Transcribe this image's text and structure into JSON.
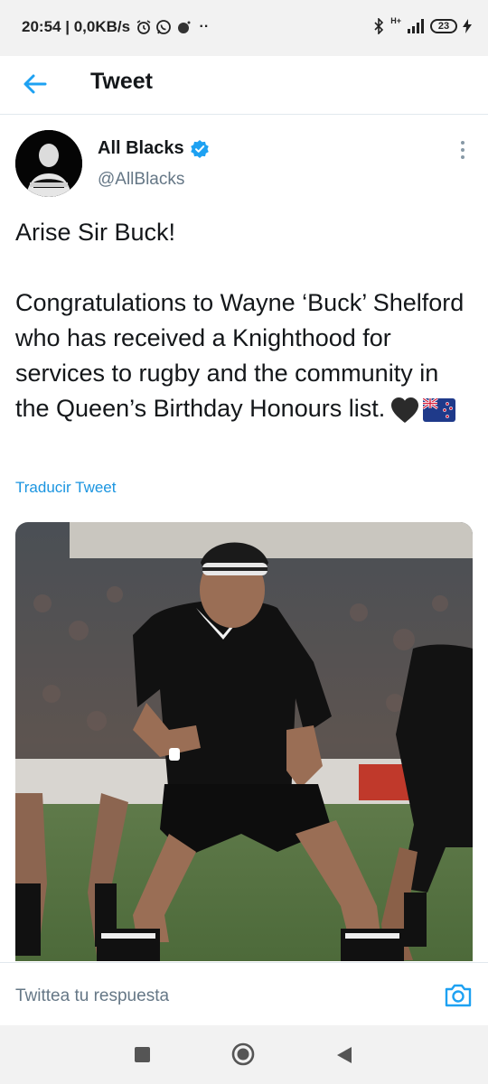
{
  "status_bar": {
    "time": "20:54",
    "speed": "0,0KB/s",
    "network": "H+",
    "battery": "23"
  },
  "header": {
    "title": "Tweet"
  },
  "tweet": {
    "display_name": "All Blacks",
    "handle": "@AllBlacks",
    "verified": true,
    "text": "Arise Sir Buck!\n\nCongratulations to Wayne ‘Buck’ Shelford who has received a Knighthood for services to rugby and the community in the Queen’s Birthday Honours list.",
    "emojis": [
      "black-heart",
      "new-zealand-flag"
    ],
    "translate_label": "Traducir Tweet"
  },
  "reply": {
    "placeholder": "Twittea tu respuesta"
  },
  "colors": {
    "accent": "#1da1f2",
    "link": "#1b95e0",
    "text": "#14171a",
    "muted": "#657786"
  }
}
